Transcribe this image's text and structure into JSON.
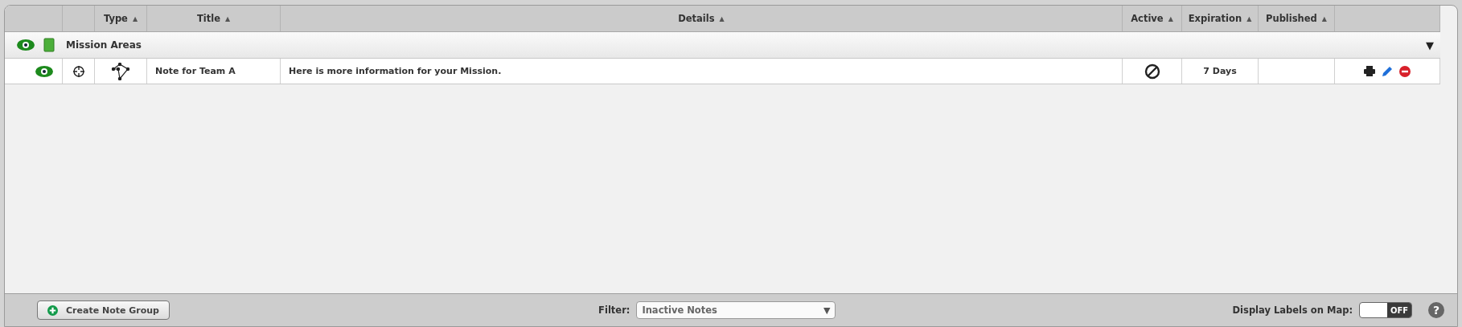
{
  "table": {
    "columns": [
      {},
      {},
      {
        "label": "Type",
        "sort": "▲"
      },
      {
        "label": "Title",
        "sort": "▲"
      },
      {
        "label": "Details",
        "sort": "▲"
      },
      {
        "label": "Active",
        "sort": "▲"
      },
      {
        "label": "Expiration",
        "sort": "▲"
      },
      {
        "label": "Published",
        "sort": "▲"
      },
      {}
    ],
    "groups": [
      {
        "name": "Mission Areas",
        "visible": true,
        "expanded": true,
        "toggle": "▼",
        "rows": [
          {
            "visible": true,
            "title": "Note for Team A",
            "details": "Here is more information for your Mission.",
            "active": false,
            "expiration": "7 Days"
          }
        ]
      }
    ]
  },
  "footer": {
    "create_button": "Create Note Group",
    "filter_label": "Filter:",
    "filter_value": "Inactive Notes",
    "filter_caret": "▼",
    "labels_label": "Display Labels on Map:",
    "labels_toggle": {
      "on": false,
      "text": "OFF"
    },
    "help": "?"
  }
}
